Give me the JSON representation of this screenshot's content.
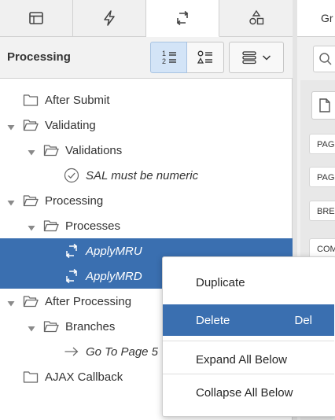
{
  "tabs": [
    {
      "icon": "table-icon",
      "active": false
    },
    {
      "icon": "lightning-icon",
      "active": false
    },
    {
      "icon": "processing-arrows-icon",
      "active": true
    },
    {
      "icon": "shapes-icon",
      "active": false
    }
  ],
  "toolbar": {
    "title": "Processing",
    "view_numbered_icon": "numbered-list-icon",
    "view_component_icon": "component-list-icon",
    "menu_icon": "stack-menu-icon"
  },
  "tree": [
    {
      "label": "After Submit",
      "level": 0,
      "toggle": "none",
      "icon": "folder-closed-icon",
      "italic": false,
      "selected": false
    },
    {
      "label": "Validating",
      "level": 0,
      "toggle": "expanded",
      "icon": "folder-open-icon",
      "italic": false,
      "selected": false
    },
    {
      "label": "Validations",
      "level": 1,
      "toggle": "expanded",
      "icon": "folder-open-icon",
      "italic": false,
      "selected": false
    },
    {
      "label": "SAL must be numeric",
      "level": 2,
      "toggle": "none",
      "icon": "check-circle-icon",
      "italic": true,
      "selected": false
    },
    {
      "label": "Processing",
      "level": 0,
      "toggle": "expanded",
      "icon": "folder-open-icon",
      "italic": false,
      "selected": false
    },
    {
      "label": "Processes",
      "level": 1,
      "toggle": "expanded",
      "icon": "folder-open-icon",
      "italic": false,
      "selected": false
    },
    {
      "label": "ApplyMRU",
      "level": 2,
      "toggle": "none",
      "icon": "process-icon",
      "italic": true,
      "selected": true
    },
    {
      "label": "ApplyMRD",
      "level": 2,
      "toggle": "none",
      "icon": "process-icon",
      "italic": true,
      "selected": true
    },
    {
      "label": "After Processing",
      "level": 0,
      "toggle": "expanded",
      "icon": "folder-open-icon",
      "italic": false,
      "selected": false
    },
    {
      "label": "Branches",
      "level": 1,
      "toggle": "expanded",
      "icon": "folder-open-icon",
      "italic": false,
      "selected": false
    },
    {
      "label": "Go To Page 5",
      "level": 2,
      "toggle": "none",
      "icon": "arrow-right-icon",
      "italic": true,
      "selected": false
    },
    {
      "label": "AJAX Callback",
      "level": 0,
      "toggle": "none",
      "icon": "folder-closed-icon",
      "italic": false,
      "selected": false
    }
  ],
  "right_panel": {
    "tab_label": "Gr",
    "items": [
      "PAG",
      "PAG",
      "BRE",
      "COM"
    ]
  },
  "context_menu": {
    "items": [
      {
        "label": "Duplicate",
        "shortcut": "",
        "highlighted": false
      },
      {
        "label": "Delete",
        "shortcut": "Del",
        "highlighted": true
      },
      {
        "label": "Expand All Below",
        "shortcut": "",
        "highlighted": false
      },
      {
        "label": "Collapse All Below",
        "shortcut": "",
        "highlighted": false
      }
    ]
  },
  "colors": {
    "selection": "#3a6fb0",
    "toolbar_active": "#d3e4f7",
    "icon_gray": "#555555"
  }
}
